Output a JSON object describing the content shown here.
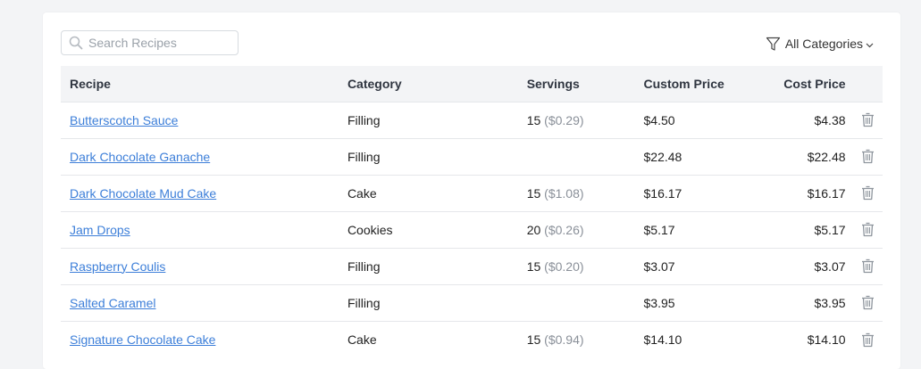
{
  "search": {
    "placeholder": "Search Recipes",
    "value": ""
  },
  "filter": {
    "label": "All Categories"
  },
  "table": {
    "headers": {
      "recipe": "Recipe",
      "category": "Category",
      "servings": "Servings",
      "custom_price": "Custom Price",
      "cost_price": "Cost Price"
    },
    "rows": [
      {
        "recipe": "Butterscotch Sauce",
        "category": "Filling",
        "servings": "15",
        "per_serving": "($0.29)",
        "custom_price": "$4.50",
        "cost_price": "$4.38"
      },
      {
        "recipe": "Dark Chocolate Ganache",
        "category": "Filling",
        "servings": "",
        "per_serving": "",
        "custom_price": "$22.48",
        "cost_price": "$22.48"
      },
      {
        "recipe": "Dark Chocolate Mud Cake",
        "category": "Cake",
        "servings": "15",
        "per_serving": "($1.08)",
        "custom_price": "$16.17",
        "cost_price": "$16.17"
      },
      {
        "recipe": "Jam Drops",
        "category": "Cookies",
        "servings": "20",
        "per_serving": "($0.26)",
        "custom_price": "$5.17",
        "cost_price": "$5.17"
      },
      {
        "recipe": "Raspberry Coulis",
        "category": "Filling",
        "servings": "15",
        "per_serving": "($0.20)",
        "custom_price": "$3.07",
        "cost_price": "$3.07"
      },
      {
        "recipe": "Salted Caramel",
        "category": "Filling",
        "servings": "",
        "per_serving": "",
        "custom_price": "$3.95",
        "cost_price": "$3.95"
      },
      {
        "recipe": "Signature Chocolate Cake",
        "category": "Cake",
        "servings": "15",
        "per_serving": "($0.94)",
        "custom_price": "$14.10",
        "cost_price": "$14.10"
      }
    ]
  },
  "icons": {
    "search": "search-icon",
    "filter": "funnel-icon",
    "dropdown": "chevron-down-icon",
    "delete": "trash-icon"
  },
  "colors": {
    "link": "#3d7fd9",
    "header_bg": "#f3f4f6",
    "muted": "#8a9099"
  }
}
